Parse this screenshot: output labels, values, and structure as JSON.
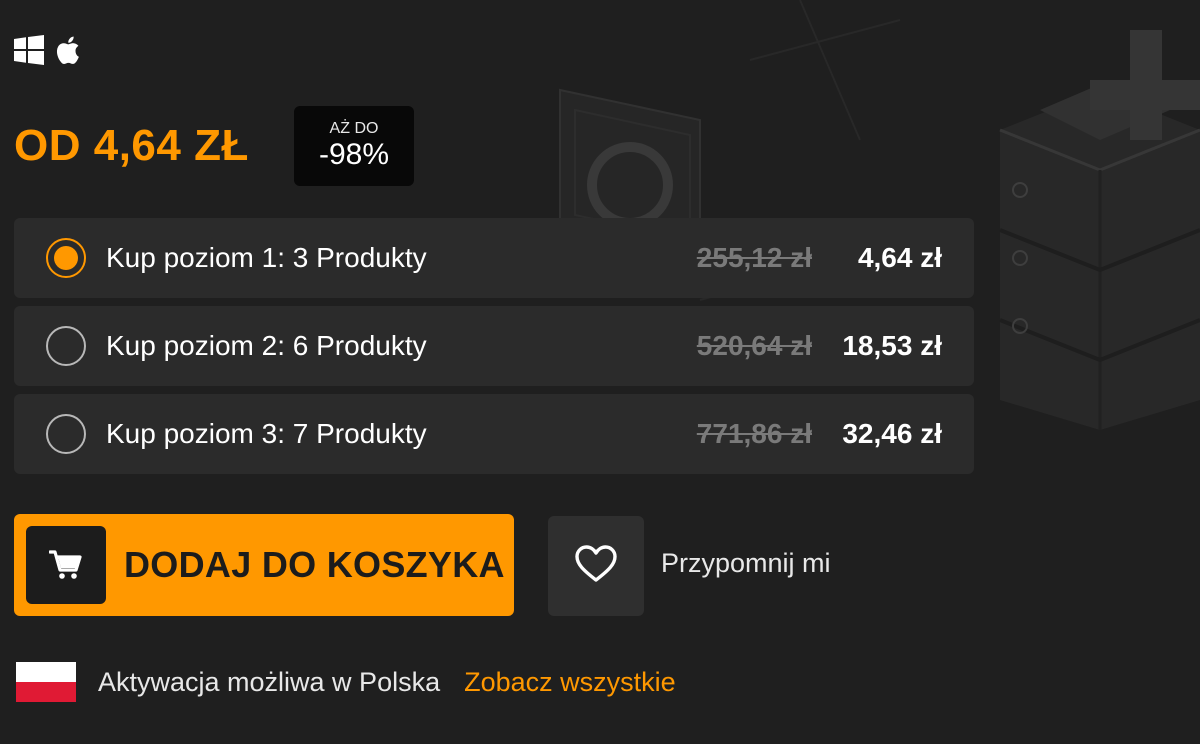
{
  "colors": {
    "accent": "#ff9800",
    "background": "#1f1f1f",
    "card": "#2b2b2b",
    "flag_white": "#ffffff",
    "flag_red": "#e01a34"
  },
  "platforms": [
    {
      "icon": "windows-icon"
    },
    {
      "icon": "apple-icon"
    }
  ],
  "price": {
    "from_label": "OD 4,64 ZŁ",
    "discount_prefix": "AŻ DO",
    "discount_value": "-98%"
  },
  "tiers": [
    {
      "label": "Kup poziom 1: 3 Produkty",
      "old_price": "255,12 zł",
      "new_price": "4,64 zł",
      "selected": true
    },
    {
      "label": "Kup poziom 2: 6 Produkty",
      "old_price": "520,64 zł",
      "new_price": "18,53 zł",
      "selected": false
    },
    {
      "label": "Kup poziom 3: 7 Produkty",
      "old_price": "771,86 zł",
      "new_price": "32,46 zł",
      "selected": false
    }
  ],
  "actions": {
    "cart_label": "DODAJ DO KOSZYKA",
    "cart_icon": "shopping-cart-icon",
    "wishlist_icon": "heart-icon",
    "wishlist_label": "Przypomnij mi"
  },
  "activation": {
    "text": "Aktywacja możliwa w Polska",
    "link": "Zobacz wszystkie",
    "flag_icon": "poland-flag-icon"
  }
}
